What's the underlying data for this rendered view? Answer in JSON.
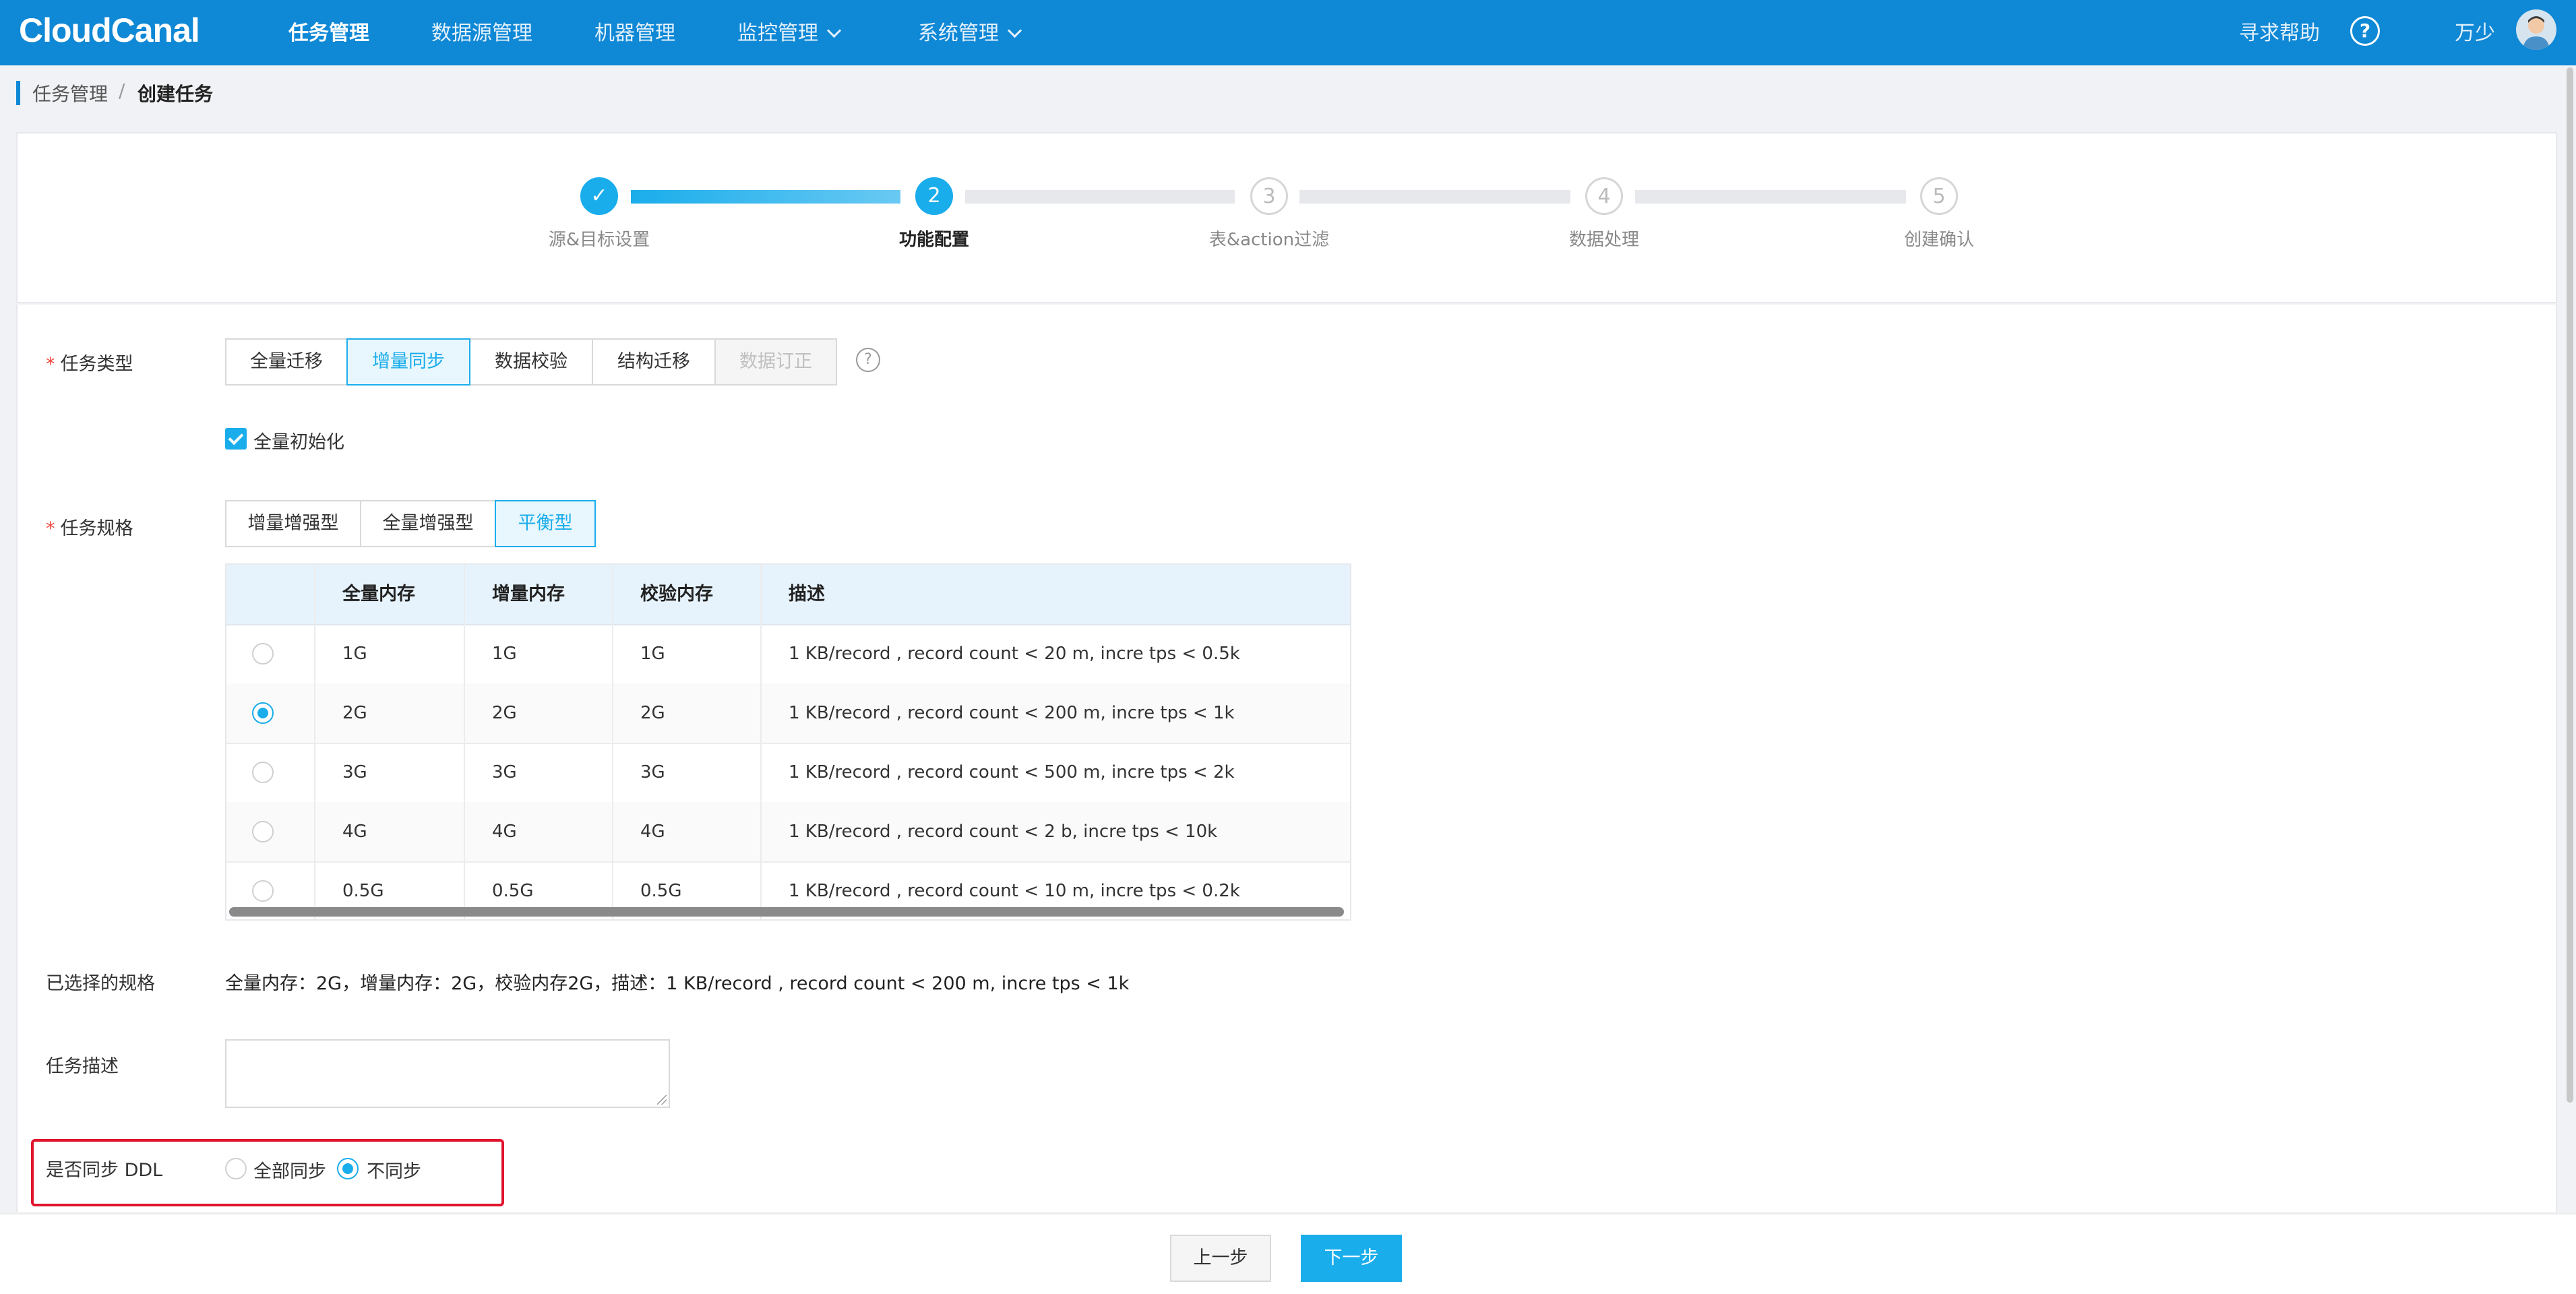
{
  "brand": {
    "logo": "CloudCanal"
  },
  "nav": {
    "items": [
      {
        "label": "任务管理",
        "active": true
      },
      {
        "label": "数据源管理"
      },
      {
        "label": "机器管理"
      },
      {
        "label": "监控管理",
        "dropdown": true
      },
      {
        "label": "系统管理",
        "dropdown": true
      }
    ],
    "help": "寻求帮助",
    "help_icon": "question-circle-icon",
    "user": "万少"
  },
  "breadcrumb": {
    "parent": "任务管理",
    "sep": "/",
    "current": "创建任务"
  },
  "steps": [
    {
      "label": "源&目标设置",
      "status": "done",
      "marker": "✓"
    },
    {
      "label": "功能配置",
      "status": "current",
      "marker": "2"
    },
    {
      "label": "表&action过滤",
      "status": "todo",
      "marker": "3"
    },
    {
      "label": "数据处理",
      "status": "todo",
      "marker": "4"
    },
    {
      "label": "创建确认",
      "status": "todo",
      "marker": "5"
    }
  ],
  "form": {
    "task_type": {
      "label": "任务类型",
      "options": [
        "全量迁移",
        "增量同步",
        "数据校验",
        "结构迁移",
        "数据订正"
      ],
      "selected": "增量同步",
      "disabled": "数据订正"
    },
    "full_init": {
      "label": "全量初始化",
      "checked": true
    },
    "task_spec": {
      "label": "任务规格",
      "options": [
        "增量增强型",
        "全量增强型",
        "平衡型"
      ],
      "selected": "平衡型"
    },
    "spec_table": {
      "headers": [
        "全量内存",
        "增量内存",
        "校验内存",
        "描述"
      ],
      "rows": [
        {
          "full": "1G",
          "incr": "1G",
          "check": "1G",
          "desc": "1 KB/record , record count < 20 m, incre tps < 0.5k",
          "selected": false
        },
        {
          "full": "2G",
          "incr": "2G",
          "check": "2G",
          "desc": "1 KB/record , record count < 200 m, incre tps < 1k",
          "selected": true
        },
        {
          "full": "3G",
          "incr": "3G",
          "check": "3G",
          "desc": "1 KB/record , record count < 500 m, incre tps < 2k",
          "selected": false
        },
        {
          "full": "4G",
          "incr": "4G",
          "check": "4G",
          "desc": "1 KB/record , record count < 2 b, incre tps < 10k",
          "selected": false
        },
        {
          "full": "0.5G",
          "incr": "0.5G",
          "check": "0.5G",
          "desc": "1 KB/record , record count < 10 m, incre tps < 0.2k",
          "selected": false
        }
      ]
    },
    "selected_spec": {
      "label": "已选择的规格",
      "value": "全量内存：2G，增量内存：2G，校验内存2G，描述：1 KB/record , record count < 200 m, incre tps < 1k"
    },
    "description": {
      "label": "任务描述",
      "value": ""
    },
    "ddl_sync": {
      "label": "是否同步 DDL",
      "options": [
        "全部同步",
        "不同步"
      ],
      "selected": "不同步"
    }
  },
  "footer": {
    "prev": "上一步",
    "next": "下一步"
  }
}
